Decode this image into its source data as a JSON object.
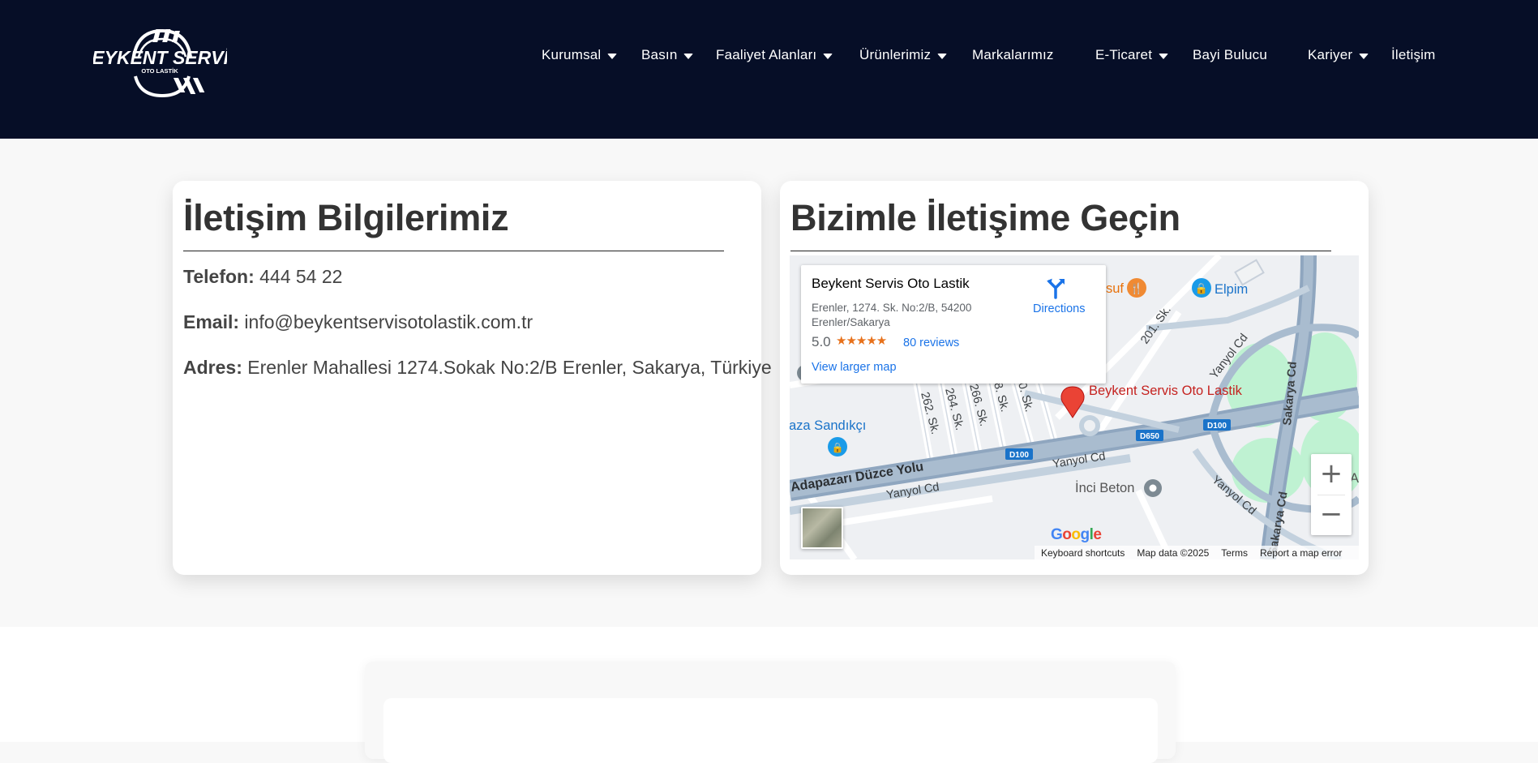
{
  "header": {
    "logo": {
      "brand": "BEYKENT SERVİS",
      "tagline": "OTO LASTİK"
    },
    "nav": [
      {
        "label": "Kurumsal",
        "has_dropdown": true
      },
      {
        "label": "Basın",
        "has_dropdown": true
      },
      {
        "label": "Faaliyet Alanları",
        "has_dropdown": true
      },
      {
        "label": "Ürünlerimiz",
        "has_dropdown": true
      },
      {
        "label": "Markalarımız",
        "has_dropdown": false
      },
      {
        "label": "E-Ticaret",
        "has_dropdown": true
      },
      {
        "label": "Bayi Bulucu",
        "has_dropdown": false
      },
      {
        "label": "Kariyer",
        "has_dropdown": true
      },
      {
        "label": "İletişim",
        "has_dropdown": false
      }
    ]
  },
  "contact_card": {
    "title": "İletişim Bilgilerimiz",
    "phone_label": "Telefon:",
    "phone": "444 54 22",
    "email_label": "Email:",
    "email": "info@beykentservisotolastik.com.tr",
    "address_label": "Adres:",
    "address": "Erenler Mahallesi 1274.Sokak No:2/B Erenler, Sakarya, Türkiye"
  },
  "map_card": {
    "title": "Bizimle İletişime Geçin",
    "infobox": {
      "place_name": "Beykent Servis Oto Lastik",
      "address": "Erenler, 1274. Sk. No:2/B, 54200 Erenler/Sakarya",
      "rating": "5.0",
      "stars": "★★★★★",
      "reviews": "80 reviews",
      "larger_map": "View larger map",
      "directions": "Directions"
    },
    "map_labels": {
      "marker": "Beykent Servis Oto Lastik",
      "poi_elpim": "Elpim",
      "poi_yusuf": "suf",
      "poi_sandikci": "aza Sandıkçı",
      "poi_inci": "İnci Beton",
      "poi_ba": "BA",
      "road_duzce": "Adapazarı Düzce Yolu",
      "road_yanyol1": "Yanyol Cd",
      "road_yanyol2": "Yanyol Cd",
      "road_yanyol3": "Yanyol Cd",
      "road_yanyol4": "Yanyol Cd",
      "road_yanyol5": "Yanyol Cd",
      "road_sakarya1": "Sakarya Cd",
      "road_sakarya2": "Sakarya Cd",
      "road_201": "201. Sk.",
      "road_262": "262. Sk.",
      "road_264": "264. Sk.",
      "road_266": "266. Sk.",
      "road_268": "8. Sk.",
      "road_270": "0. Sk.",
      "shield_d100a": "D100",
      "shield_d100b": "D100",
      "shield_d650": "D650"
    },
    "zoom_in": "+",
    "zoom_out": "−",
    "google": [
      "G",
      "o",
      "o",
      "g",
      "l",
      "e"
    ],
    "footer": {
      "shortcuts": "Keyboard shortcuts",
      "data": "Map data ©2025",
      "terms": "Terms",
      "report": "Report a map error"
    }
  },
  "colors": {
    "header_bg": "#060e27",
    "marker_red": "#ea4335",
    "link_blue": "#1a73e8",
    "road": "#8fa6bf",
    "park_green": "#bff2d2"
  }
}
